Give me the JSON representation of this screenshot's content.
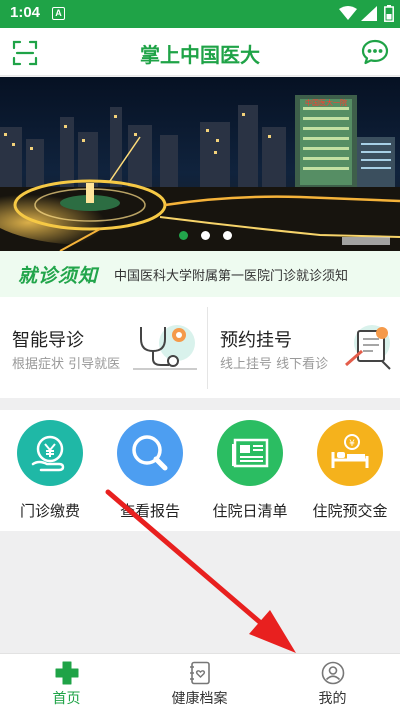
{
  "status_bar": {
    "time": "1:04",
    "notification_letter": "A"
  },
  "header": {
    "title": "掌上中国医大",
    "left_icon": "scan-icon",
    "right_icon": "chat-icon"
  },
  "banner": {
    "sign_text": "中国医大一院",
    "slide_count": 3,
    "active_slide": 1
  },
  "notice": {
    "badge": "就诊须知",
    "text": "中国医科大学附属第一医院门诊就诊须知"
  },
  "cards": [
    {
      "title": "智能导诊",
      "subtitle": "根据症状 引导就医",
      "icon": "stethoscope-icon"
    },
    {
      "title": "预约挂号",
      "subtitle": "线上挂号 线下看诊",
      "icon": "appointment-icon"
    }
  ],
  "services": [
    {
      "label": "门诊缴费",
      "icon": "payment-icon",
      "color": "#1fb8a6"
    },
    {
      "label": "查看报告",
      "icon": "search-icon",
      "color": "#4d9ef1"
    },
    {
      "label": "住院日清单",
      "icon": "newspaper-icon",
      "color": "#2bbd62"
    },
    {
      "label": "住院预交金",
      "icon": "hospital-bed-icon",
      "color": "#f5b21c"
    }
  ],
  "bottom_nav": [
    {
      "label": "首页",
      "icon": "home-cross-icon",
      "active": true
    },
    {
      "label": "健康档案",
      "icon": "health-record-icon",
      "active": false
    },
    {
      "label": "我的",
      "icon": "profile-icon",
      "active": false
    }
  ],
  "colors": {
    "brand_green": "#1fa347",
    "annotation_arrow": "#e8201f"
  }
}
